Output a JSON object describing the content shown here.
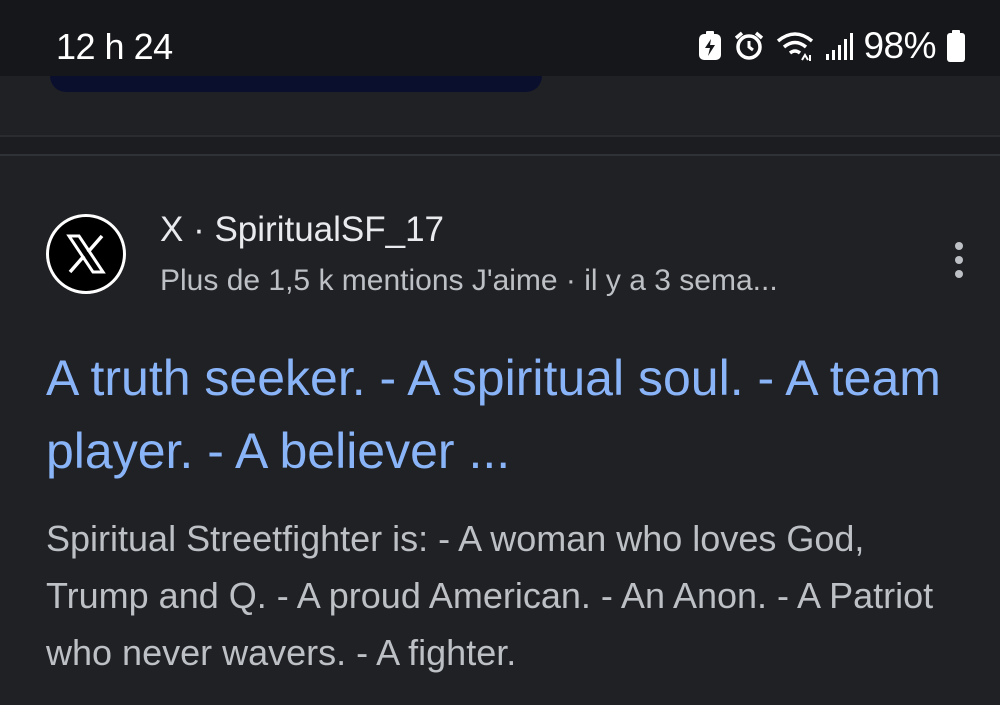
{
  "status_bar": {
    "time": "12 h 24",
    "battery_percent": "98%",
    "icons": [
      "battery-saver-icon",
      "alarm-icon",
      "wifi-icon",
      "signal-icon",
      "battery-icon"
    ]
  },
  "result": {
    "favicon": "x-logo-icon",
    "source": "X · SpiritualSF_17",
    "meta": "Plus de 1,5 k mentions J'aime · il y a 3 sema...",
    "title": "A truth seeker. - A spiritual soul. - A team player. - A believer ...",
    "snippet": "Spiritual Streetfighter is: - A woman who loves God, Trump and Q. - A proud American. - An Anon. - A Patriot who never wavers. - A fighter.",
    "more_icon": "more-vert-icon"
  },
  "colors": {
    "background": "#202124",
    "status_bar": "#16171a",
    "link": "#8ab4f8",
    "snippet_text": "#bdc1c6",
    "primary_text": "#e8eaed"
  }
}
